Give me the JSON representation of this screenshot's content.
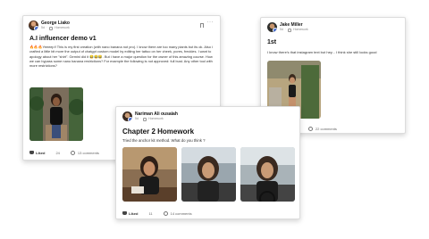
{
  "posts": [
    {
      "author": "George Liako",
      "meta_time": "5d",
      "meta_category": "Homework",
      "title": "A.I influencer demo v1",
      "body": "🔥🔥🔥Yeeeep!! This is my first creation (with nano banana not pro). I know there are too many plants but its ok. Also i crafted a little bit more the output of chatgpt custom model by editing her tattoo on her cheek, pores, freckles. I want to apology about her \"shirt\". Gemini did it 😂😂😂. But i have a major question for the owner of this amazing course. How we can bypass some nano banana restrictions? For example the following is not approved: full bust. Any other tool with more restrictions?",
      "like_label": "Liked",
      "likes": "24",
      "comments": "13 comments",
      "more": "···",
      "image_desc": "woman in black top in a room with plants"
    },
    {
      "author": "Jake Miller",
      "meta_time": "5d",
      "meta_category": "Homework",
      "title": "1st",
      "body": "I know there's that instagram text but hey... I think she still looks good",
      "like_label": "Liked",
      "likes": "16",
      "comments": "22 comments"
    },
    {
      "author": "Nariman Ali ousaiah",
      "meta_time": "5d",
      "meta_category": "Homework",
      "title": "Chapter 2 Homework",
      "body": "Tried the anchor kit method. What do you think ?",
      "like_label": "Liked",
      "likes": "11",
      "comments": "14 comments"
    }
  ],
  "colors": {
    "accent": "#4a6fd1",
    "like": "#333333",
    "border": "#dcdcdc"
  },
  "icons": [
    "avatar",
    "like-icon",
    "comment-icon",
    "more-icon",
    "category-icon"
  ]
}
